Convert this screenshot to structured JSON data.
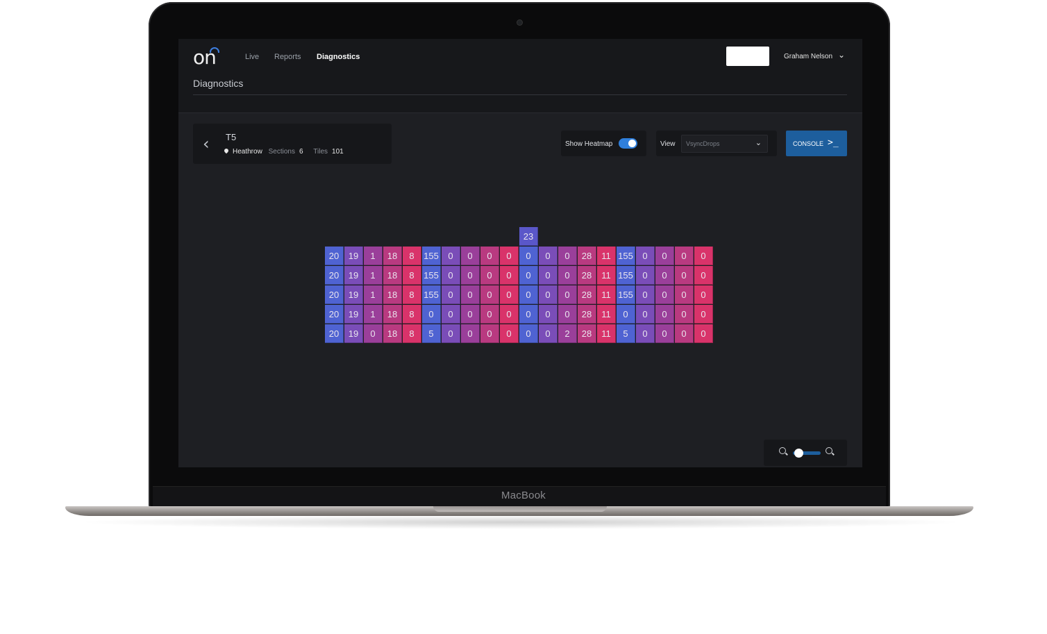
{
  "device": {
    "label": "MacBook"
  },
  "app": {
    "logo_text": "on",
    "nav": [
      {
        "label": "Live",
        "active": false
      },
      {
        "label": "Reports",
        "active": false
      },
      {
        "label": "Diagnostics",
        "active": true
      }
    ],
    "user_name": "Graham Nelson",
    "page_title": "Diagnostics"
  },
  "location": {
    "name": "T5",
    "site": "Heathrow",
    "sections_label": "Sections",
    "sections": "6",
    "tiles_label": "Tiles",
    "tiles": "101"
  },
  "controls": {
    "heatmap_label": "Show Heatmap",
    "heatmap_on": true,
    "view_label": "View",
    "view_value": "VsyncDrops",
    "console_label": "CONSOLE",
    "zoom_level": 0.15
  },
  "heatmap": {
    "extra_tile": {
      "value": "23",
      "column": 10,
      "color": "#5a57c9"
    },
    "column_colors": [
      "#4f63d2",
      "#7a4db8",
      "#9a3f9a",
      "#b93a80",
      "#d9336a",
      "#4f63d2",
      "#7a4db8",
      "#9a3f9a",
      "#b93a80",
      "#d9336a",
      "#4f63d2",
      "#7a4db8",
      "#9a3f9a",
      "#b93a80",
      "#d9336a",
      "#4f63d2",
      "#7a4db8",
      "#9a3f9a",
      "#b93a80",
      "#d9336a"
    ],
    "rows": [
      [
        "20",
        "19",
        "1",
        "18",
        "8",
        "155",
        "0",
        "0",
        "0",
        "0",
        "0",
        "0",
        "0",
        "28",
        "11",
        "155",
        "0",
        "0",
        "0",
        "0"
      ],
      [
        "20",
        "19",
        "1",
        "18",
        "8",
        "155",
        "0",
        "0",
        "0",
        "0",
        "0",
        "0",
        "0",
        "28",
        "11",
        "155",
        "0",
        "0",
        "0",
        "0"
      ],
      [
        "20",
        "19",
        "1",
        "18",
        "8",
        "155",
        "0",
        "0",
        "0",
        "0",
        "0",
        "0",
        "0",
        "28",
        "11",
        "155",
        "0",
        "0",
        "0",
        "0"
      ],
      [
        "20",
        "19",
        "1",
        "18",
        "8",
        "0",
        "0",
        "0",
        "0",
        "0",
        "0",
        "0",
        "0",
        "28",
        "11",
        "0",
        "0",
        "0",
        "0",
        "0"
      ],
      [
        "20",
        "19",
        "0",
        "18",
        "8",
        "5",
        "0",
        "0",
        "0",
        "0",
        "0",
        "0",
        "2",
        "28",
        "11",
        "5",
        "0",
        "0",
        "0",
        "0"
      ]
    ]
  }
}
